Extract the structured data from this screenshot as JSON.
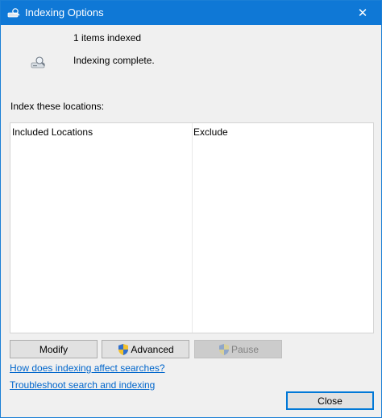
{
  "window": {
    "title": "Indexing Options",
    "close_glyph": "✕"
  },
  "status": {
    "count_text": "1 items indexed",
    "message": "Indexing complete.",
    "icon": "drive-search-icon"
  },
  "locations": {
    "label": "Index these locations:",
    "columns": [
      "Included Locations",
      "Exclude"
    ]
  },
  "buttons": {
    "modify": "Modify",
    "advanced": "Advanced",
    "pause": "Pause",
    "close": "Close"
  },
  "links": {
    "how_indexing": "How does indexing affect searches?",
    "troubleshoot": "Troubleshoot search and indexing"
  },
  "colors": {
    "titlebar": "#0f78d6",
    "link": "#0066cc",
    "window_bg": "#f0f0f0"
  }
}
